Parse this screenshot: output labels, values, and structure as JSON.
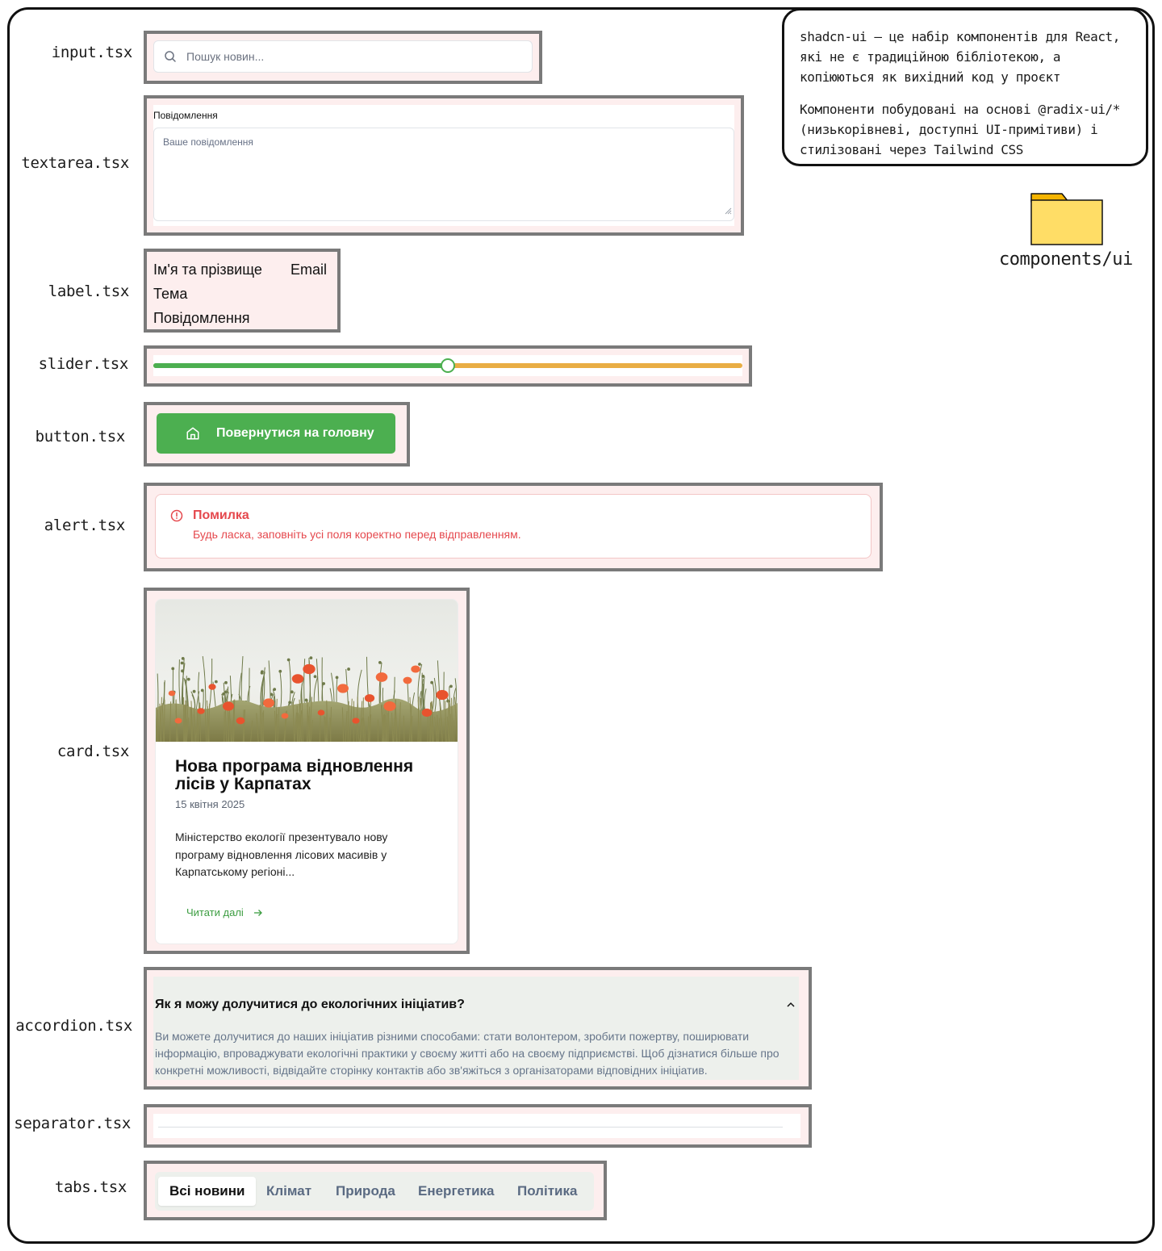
{
  "labels": {
    "input": "input.tsx",
    "textarea": "textarea.tsx",
    "label": "label.tsx",
    "slider": "slider.tsx",
    "button": "button.tsx",
    "alert": "alert.tsx",
    "card": "card.tsx",
    "accordion": "accordion.tsx",
    "separator": "separator.tsx",
    "tabs": "tabs.tsx"
  },
  "input": {
    "placeholder": "Пошук новин...",
    "icon": "search-icon"
  },
  "textarea": {
    "label": "Повідомлення",
    "placeholder": "Ваше повідомлення"
  },
  "label_demo": {
    "name": "Ім'я та прізвище",
    "email": "Email",
    "subject": "Тема",
    "message": "Повідомлення"
  },
  "slider": {
    "value_percent": 50,
    "filled_color": "#4caf50",
    "track_color": "#e9ad44"
  },
  "button": {
    "label": "Повернутися на головну",
    "icon": "home-icon",
    "color": "#4caf50"
  },
  "alert": {
    "title": "Помилка",
    "description": "Будь ласка, заповніть усі поля коректно перед відправленням.",
    "icon": "alert-circle-icon",
    "color": "#e5484d"
  },
  "card": {
    "image": "poppy-field-photo",
    "title": "Нова програма відновлення лісів у Карпатах",
    "date": "15 квітня 2025",
    "description": "Міністерство екології презентувало нову програму відновлення лісових масивів у Карпатському регіоні...",
    "link": "Читати далі",
    "link_icon": "arrow-right-icon"
  },
  "accordion": {
    "question": "Як я можу долучитися до екологічних ініціатив?",
    "answer": "Ви можете долучитися до наших ініціатив різними способами: стати волонтером, зробити пожертву, поширювати інформацію, впроваджувати екологічні практики у своєму житті або на своєму підприємстві. Щоб дізнатися більше про конкретні можливості, відвідайте сторінку контактів або зв'яжіться з організаторами відповідних ініціатив.",
    "expanded": true
  },
  "tabs": {
    "items": [
      "Всі новини",
      "Клімат",
      "Природа",
      "Енергетика",
      "Політика"
    ],
    "active": "Всі новини"
  },
  "note": {
    "p1": "shadcn-ui — це набір компонентів для React, які не є традиційною бібліотекою, а копіюються як вихідний код у проєкт",
    "p2": "Компоненти побудовані на основі @radix-ui/* (низькорівневі, доступні UI-примітиви) і стилізовані через Tailwind CSS"
  },
  "folder": {
    "label": "components/ui",
    "icon": "folder-icon",
    "color": "#ffdd66"
  }
}
